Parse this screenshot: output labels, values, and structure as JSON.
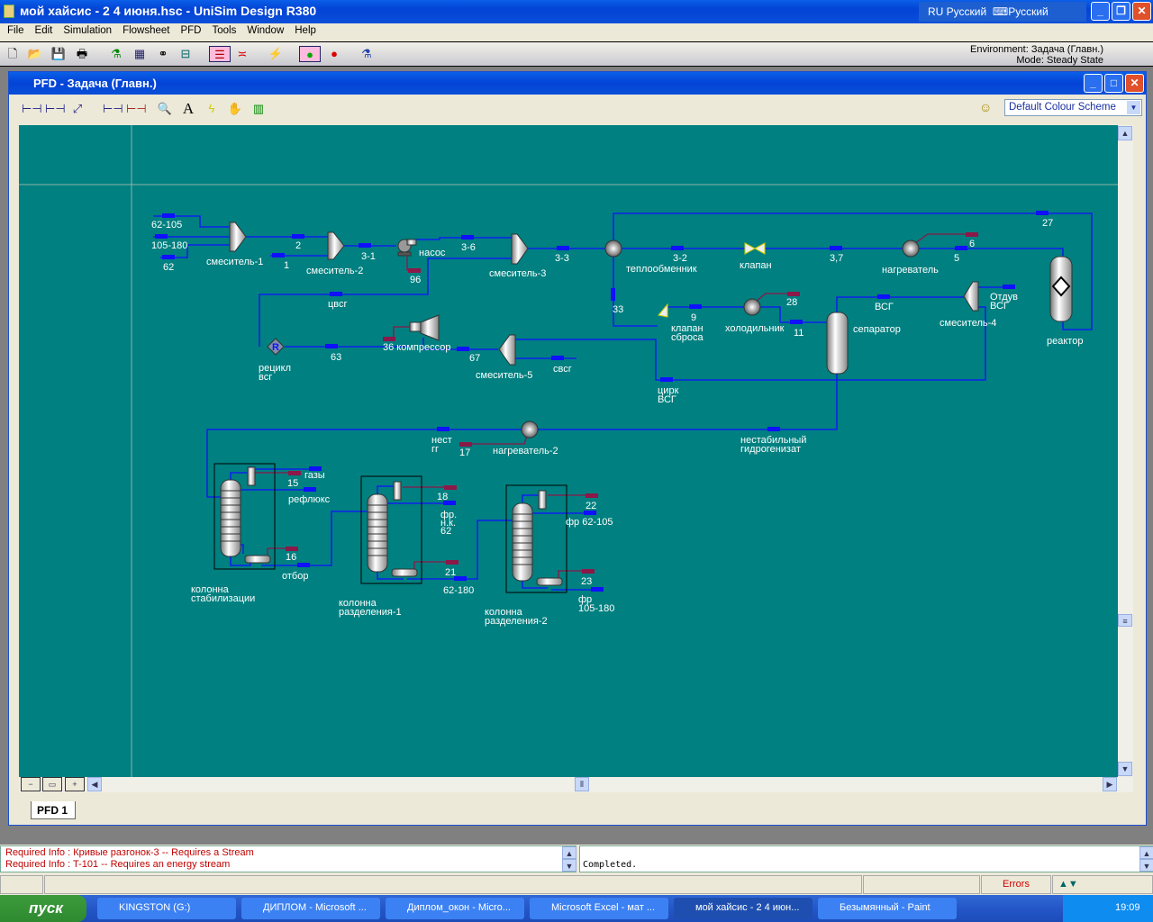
{
  "app": {
    "title": "мой хайсис - 2 4 июня.hsc - UniSim Design R380",
    "lang_indicator": "RU Русский",
    "keyboard": "Русский"
  },
  "menu": [
    "File",
    "Edit",
    "Simulation",
    "Flowsheet",
    "PFD",
    "Tools",
    "Window",
    "Help"
  ],
  "environment": {
    "env": "Environment: Задача (Главн.)",
    "mode": "Mode: Steady State"
  },
  "pfd_window": {
    "title": "PFD - Задача (Главн.)",
    "colour_scheme": "Default Colour Scheme",
    "tab": "PFD 1"
  },
  "flowsheet": {
    "labels": {
      "s62_105": "62-105",
      "s105_180": "105-180",
      "s62": "62",
      "mix1": "смеситель-1",
      "s2": "2",
      "s1": "1",
      "mix2": "смеситель-2",
      "s3_1": "3-1",
      "pump": "насос",
      "e96": "96",
      "s3_6": "3-6",
      "mix3": "смеситель-3",
      "s3_3": "3-3",
      "hx": "теплообменник",
      "s3_2": "3-2",
      "valve": "клапан",
      "s3_7": "3,7",
      "heater": "нагреватель",
      "e6": "6",
      "s5": "5",
      "s27": "27",
      "reactor": "реактор",
      "s33": "33",
      "s9": "9",
      "relief1": "клапан",
      "relief2": "сброса",
      "cooler": "холодильник",
      "e28": "28",
      "s11": "11",
      "separator": "сепаратор",
      "vsg": "ВСГ",
      "purge1": "Отдув",
      "purge2": "ВСГ",
      "mix4": "смеситель-4",
      "cvsg": "цвсг",
      "recycle1": "рецикл",
      "recycle2": "всг",
      "s63": "63",
      "compressor": "36 компрессор",
      "s67": "67",
      "mix5": "смеситель-5",
      "svsg": "свсг",
      "circ1": "цирк",
      "circ2": "ВСГ",
      "nest1": "нест",
      "nest2": "гг",
      "e17": "17",
      "heater2": "нагреватель-2",
      "unstable1": "нестабильный",
      "unstable2": "гидрогенизат",
      "gases": "газы",
      "e15": "15",
      "reflux": "рефлюкс",
      "e16": "16",
      "draw": "отбор",
      "col1a": "колонна",
      "col1b": "стабилизации",
      "e18": "18",
      "fr1": "фр.",
      "fr2": "н.к.",
      "fr3": "62",
      "e21": "21",
      "s62_180": "62-180",
      "col2a": "колонна",
      "col2b": "разделения-1",
      "e22": "22",
      "fr62_105": "фр 62-105",
      "e23": "23",
      "fr4": "фр",
      "fr5": "105-180",
      "col3a": "колонна",
      "col3b": "разделения-2"
    }
  },
  "messages": {
    "left": [
      "Required Info : Кривые разгонок-3 -- Requires a Stream",
      "Required Info : T-101 -- Requires an energy stream"
    ],
    "right": "Completed.",
    "errors": "Errors"
  },
  "taskbar": {
    "start": "пуск",
    "items": [
      "KINGSTON (G:)",
      "ДИПЛОМ - Microsoft ...",
      "Диплом_окон - Micro...",
      "Microsoft Excel - мат ...",
      "мой хайсис - 2 4 июн...",
      "Безымянный - Paint"
    ],
    "clock": "19:09"
  },
  "colors": {
    "stream": "#0000ff",
    "energy": "#8b1848",
    "canvas": "#008080"
  }
}
